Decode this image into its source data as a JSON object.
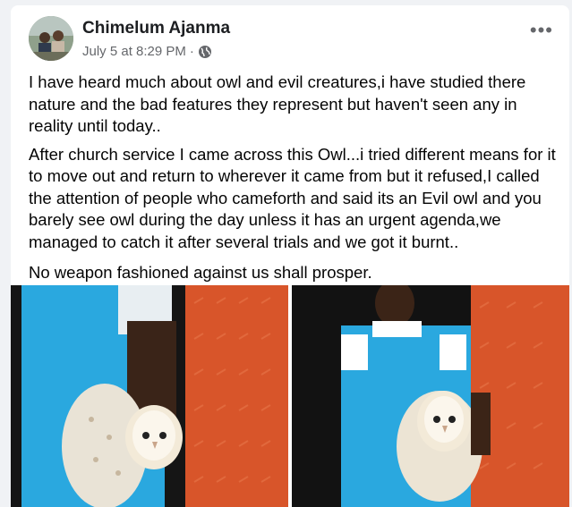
{
  "post": {
    "author": "Chimelum Ajanma",
    "date": "July 5 at 8:29 PM",
    "separator": "·",
    "audience_icon": "globe-icon",
    "more_label": "•••",
    "paragraphs": [
      "I have heard much about owl and evil creatures,i have studied there nature and the bad features they represent but haven't seen any in reality until today..",
      "After church service I came across this Owl...i tried different means for it to move out and return to wherever it came from but it refused,I called the attention of people who cameforth and said its an Evil owl and you barely see owl during the day unless it has an urgent agenda,we managed to catch it after several trials and we got it burnt..",
      "No weapon fashioned against us shall prosper."
    ]
  },
  "colors": {
    "background": "#f0f2f5",
    "card": "#ffffff",
    "text": "#050505",
    "meta": "#65676b",
    "door_orange": "#d8552a",
    "shirt_blue": "#29a9e0"
  }
}
